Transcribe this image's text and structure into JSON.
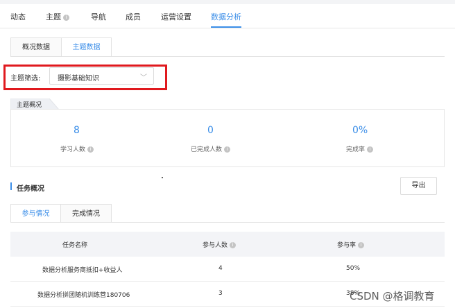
{
  "nav": {
    "items": [
      {
        "label": "动态",
        "has_info": false,
        "active": false
      },
      {
        "label": "主题",
        "has_info": true,
        "active": false
      },
      {
        "label": "导航",
        "has_info": false,
        "active": false
      },
      {
        "label": "成员",
        "has_info": false,
        "active": false
      },
      {
        "label": "运营设置",
        "has_info": false,
        "active": false
      },
      {
        "label": "数据分析",
        "has_info": false,
        "active": true
      }
    ]
  },
  "subtabs": [
    "概况数据",
    "主题数据"
  ],
  "filter": {
    "label": "主题筛选:",
    "value": "摄影基础知识"
  },
  "overview": {
    "tag": "主题概况",
    "stats": [
      {
        "value": "8",
        "label": "学习人数"
      },
      {
        "value": "0",
        "label": "已完成人数"
      },
      {
        "value": "0%",
        "label": "完成率"
      }
    ]
  },
  "tasks": {
    "title": "任务概况",
    "export_label": "导出",
    "tabs": [
      "参与情况",
      "完成情况"
    ],
    "columns": [
      "任务名称",
      "参与人数",
      "参与率"
    ],
    "rows": [
      [
        "数据分析服务商抵扣+收益人",
        "4",
        "50%"
      ],
      [
        "数据分析拼团随机训练营180706",
        "3",
        "38%"
      ]
    ]
  },
  "watermark": "CSDN @格调教育",
  "colors": {
    "accent": "#3b8ee8",
    "highlight_box": "#e0191e"
  }
}
